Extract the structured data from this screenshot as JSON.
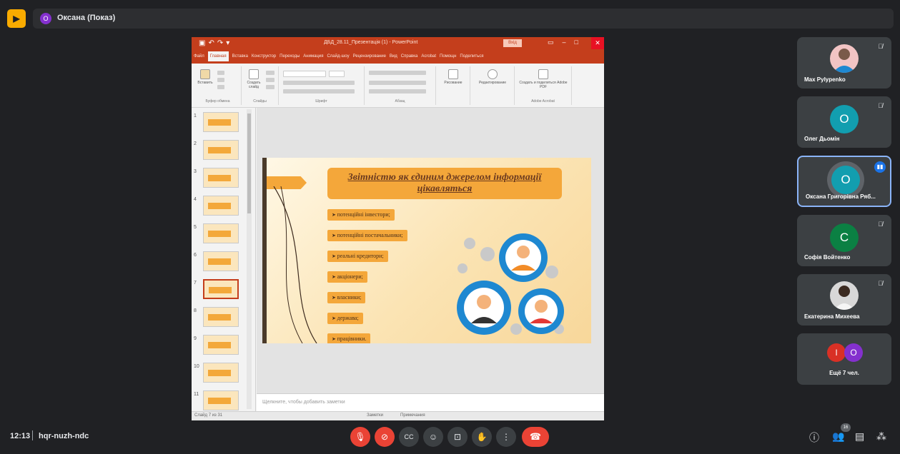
{
  "presenting": {
    "avatar_letter": "О",
    "name": "Оксана (Показ)"
  },
  "powerpoint": {
    "doc_title": "ДБД_28.11_Презентація (1) - PowerPoint",
    "sign_in": "Вхід",
    "menu": [
      "Файл",
      "Главная",
      "Вставка",
      "Конструктор",
      "Переходы",
      "Анимация",
      "Слайд-шоу",
      "Рецензирование",
      "Вид",
      "Справка",
      "Acrobat",
      "Помощн",
      "Поделиться"
    ],
    "active_menu": "Главная",
    "ribbon_groups": [
      "Буфер обмена",
      "Слайды",
      "Шрифт",
      "Абзац",
      "Рисование",
      "Редактирование",
      "Adobe Acrobat"
    ],
    "ribbon_buttons": {
      "paste": "Вставить",
      "new_slide": "Создать слайд",
      "drawing": "Рисование",
      "editing": "Редактирование",
      "adobe": "Создать и поделиться Adobe PDF"
    },
    "thumb_numbers": [
      "1",
      "2",
      "3",
      "4",
      "5",
      "6",
      "7",
      "8",
      "9",
      "10",
      "11"
    ],
    "selected_thumb": 7,
    "notes_placeholder": "Щелкните, чтобы добавить заметки",
    "status_left": "Слайд 7 из 31",
    "status_right": "Заметки",
    "status_view": "Примечания",
    "slide": {
      "title": "Звітністю як єдиним джерелом інформації цікавляться",
      "bullets": [
        "потенційні інвестори;",
        "потенційні постачальники;",
        "реальні кредитори;",
        "акціонери;",
        "власники;",
        "держава;",
        "працівники."
      ]
    }
  },
  "participants": [
    {
      "name": "Max Pylypenko",
      "type": "photo",
      "muted": true
    },
    {
      "name": "Олег Дьомін",
      "letter": "О",
      "color": "#129eaf",
      "muted": true
    },
    {
      "name": "Оксана Григорівна Ряб...",
      "letter": "О",
      "color": "#129eaf",
      "speaking": true
    },
    {
      "name": "Софія Войтенко",
      "letter": "С",
      "color": "#0b8043",
      "muted": true
    },
    {
      "name": "Екатерина Михеева",
      "type": "photo",
      "muted": true
    },
    {
      "name": "Ещё 7 чел.",
      "letters": [
        "І",
        "О"
      ],
      "colors": [
        "#d93025",
        "#8430ce"
      ]
    }
  ],
  "bottom_bar": {
    "time": "12:13",
    "meeting_code": "hqr-nuzh-ndc",
    "participant_count": "16"
  },
  "colors": {
    "accent": "#ea4335",
    "tile_bg": "#3c4043",
    "ppt": "#c43e1c",
    "slide_orange": "#f4a73a"
  }
}
